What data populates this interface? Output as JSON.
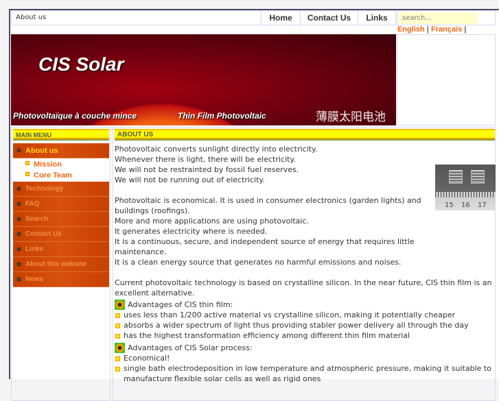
{
  "topbar": {
    "breadcrumb": "About us",
    "nav": [
      "Home",
      "Contact Us",
      "Links"
    ],
    "search_placeholder": "search..."
  },
  "languages": {
    "english": "English",
    "french": "Français",
    "sep": "|"
  },
  "banner": {
    "logo": "CIS Solar",
    "french_tagline": "Photovoltaïque à couche mince",
    "english_tagline": "Thin Film Photovoltaic",
    "chinese_tagline": "薄膜太阳电池"
  },
  "sidebar": {
    "title": "MAIN MENU",
    "active": "About us",
    "submenu": [
      "Mission",
      "Core Team"
    ],
    "items": [
      "Technology",
      "FAQ",
      "Search",
      "Contact Us",
      "Links",
      "About this website",
      "News"
    ]
  },
  "main": {
    "title": "ABOUT US",
    "paragraphs": [
      [
        "Photovoltaic converts sunlight directly into electricity.",
        "Whenever there is light, there will be electricity.",
        "We will not be restrainted by fossil fuel reserves.",
        "We will not be running out of electricity."
      ],
      [
        "Photovoltaic is economical. It is used in consumer electronics (garden lights) and buildings (roofings).",
        "More and more applications are using photovoltaic.",
        "It generates electricity where is needed.",
        "It is a continuous, secure, and independent source of energy that requires little maintenance.",
        "It is a clean energy source that generates no harmful emissions and noises."
      ],
      [
        "Current photovoltaic technology is based on crystalline silicon. In the near future, CIS thin film is an excellent alternative."
      ]
    ],
    "adv1": {
      "title": "Advantages of CIS thin film:",
      "items": [
        "uses less than 1/200 active material vs crystalline silicon, making it potentially cheaper",
        "absorbs a wider spectrum of light thus providing stabler power delivery all through the day",
        "has the highest transformation efficiency among different thin film material"
      ]
    },
    "adv2": {
      "title": "Advantages of CIS Solar process:",
      "items": [
        "Economical!",
        "single bath electrodeposition in low temperature and atmospheric pressure, making it suitable to manufacture flexible solar cells as well as rigid ones"
      ]
    },
    "thumb_ruler": [
      "15",
      "16",
      "17"
    ]
  }
}
